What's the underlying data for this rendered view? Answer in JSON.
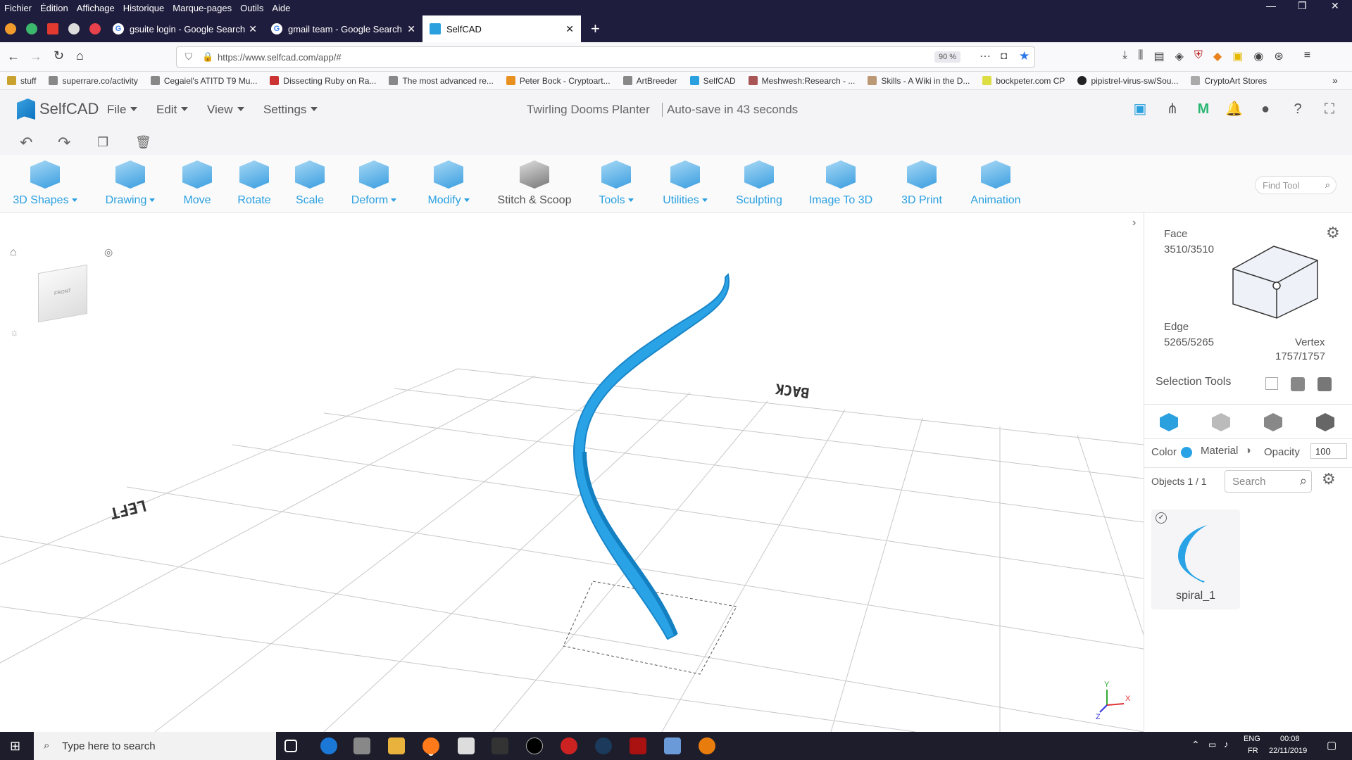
{
  "browser_menu": [
    "Fichier",
    "Édition",
    "Affichage",
    "Historique",
    "Marque-pages",
    "Outils",
    "Aide"
  ],
  "window_controls": [
    "—",
    "❐",
    "✕"
  ],
  "tabs": [
    {
      "title": "gsuite login - Google Search",
      "active": false
    },
    {
      "title": "gmail team - Google Search",
      "active": false
    },
    {
      "title": "SelfCAD",
      "active": true
    }
  ],
  "new_tab": "+",
  "url": "https://www.selfcad.com/app/#",
  "zoom": "90 %",
  "bookmarks": [
    "stuff",
    "superrare.co/activity",
    "Cegaiel's ATITD T9 Mu...",
    "Dissecting Ruby on Ra...",
    "The most advanced re...",
    "Peter Bock - Cryptoart...",
    "ArtBreeder",
    "SelfCAD",
    "Meshwesh:Research - ...",
    "Skills - A Wiki in the D...",
    "bockpeter.com CP",
    "pipistrel-virus-sw/Sou...",
    "CryptoArt Stores"
  ],
  "app": {
    "logo": "SelfCAD",
    "menus": [
      "File",
      "Edit",
      "View",
      "Settings"
    ],
    "doc_name": "Twirling Dooms Planter",
    "autosave": "Auto-save in 43 seconds"
  },
  "tools": [
    {
      "label": "3D Shapes",
      "dd": true
    },
    {
      "label": "Drawing",
      "dd": true
    },
    {
      "label": "Move",
      "dd": false
    },
    {
      "label": "Rotate",
      "dd": false
    },
    {
      "label": "Scale",
      "dd": false
    },
    {
      "label": "Deform",
      "dd": true
    },
    {
      "label": "Modify",
      "dd": true
    },
    {
      "label": "Stitch & Scoop",
      "dd": false,
      "dark": true
    },
    {
      "label": "Tools",
      "dd": true
    },
    {
      "label": "Utilities",
      "dd": true
    },
    {
      "label": "Sculpting",
      "dd": false
    },
    {
      "label": "Image To 3D",
      "dd": false
    },
    {
      "label": "3D Print",
      "dd": false
    },
    {
      "label": "Animation",
      "dd": false
    }
  ],
  "find_tool": "Find Tool",
  "viewport": {
    "left_label": "LEFT",
    "back_label": "BACK",
    "cube_face": "FRONT",
    "axis_x": "X",
    "axis_y": "Y",
    "axis_z": "Z"
  },
  "panel": {
    "face_label": "Face",
    "face_value": "3510/3510",
    "edge_label": "Edge",
    "edge_value": "5265/5265",
    "vertex_label": "Vertex",
    "vertex_value": "1757/1757",
    "selection_tools": "Selection Tools",
    "color_label": "Color",
    "color_value": "#29a3e6",
    "material_label": "Material",
    "opacity_label": "Opacity",
    "opacity_value": "100",
    "objects_label": "Objects 1 / 1",
    "search_placeholder": "Search",
    "object_name": "spiral_1"
  },
  "taskbar": {
    "search_placeholder": "Type here to search",
    "lang1": "ENG",
    "lang2": "FR",
    "time": "00:08",
    "date": "22/11/2019"
  }
}
